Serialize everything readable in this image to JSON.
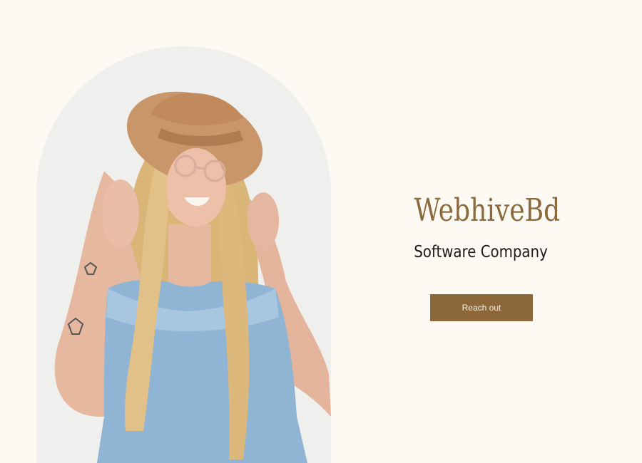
{
  "hero": {
    "image_description_name": "woman-in-hat-photo",
    "accent_color": "#8b6a3e"
  },
  "brand": {
    "title": "WebhiveBd",
    "tagline": "Software Company"
  },
  "cta": {
    "label": "Reach out",
    "color": "#8b673a"
  },
  "colors": {
    "background": "#fdfaf3",
    "title": "#8b6a3e",
    "tagline": "#1c1c1c",
    "button_text": "#f7efe2"
  }
}
